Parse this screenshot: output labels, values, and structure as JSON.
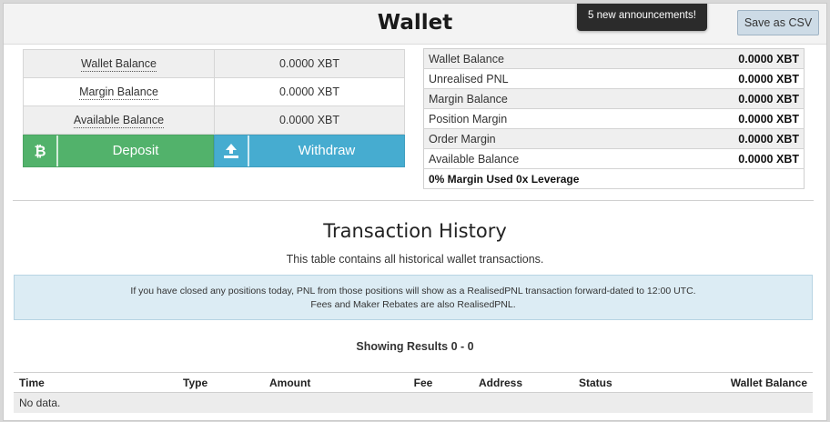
{
  "header": {
    "title": "Wallet",
    "save_csv_label": "Save as CSV",
    "announcement": "5 new announcements!"
  },
  "balances": {
    "rows": [
      {
        "label": "Wallet Balance",
        "value": "0.0000 XBT"
      },
      {
        "label": "Margin Balance",
        "value": "0.0000 XBT"
      },
      {
        "label": "Available Balance",
        "value": "0.0000 XBT"
      }
    ],
    "deposit_label": "Deposit",
    "withdraw_label": "Withdraw",
    "deposit_icon": "bitcoin-icon",
    "withdraw_icon": "upload-icon",
    "deposit_color": "#52b26b",
    "withdraw_color": "#46acd0"
  },
  "summary": {
    "rows": [
      {
        "label": "Wallet Balance",
        "value": "0.0000 XBT"
      },
      {
        "label": "Unrealised PNL",
        "value": "0.0000 XBT"
      },
      {
        "label": "Margin Balance",
        "value": "0.0000 XBT"
      },
      {
        "label": "Position Margin",
        "value": "0.0000 XBT"
      },
      {
        "label": "Order Margin",
        "value": "0.0000 XBT"
      },
      {
        "label": "Available Balance",
        "value": "0.0000 XBT"
      }
    ],
    "footer": "0% Margin Used 0x Leverage"
  },
  "history": {
    "title": "Transaction History",
    "subtitle": "This table contains all historical wallet transactions.",
    "info_line1": "If you have closed any positions today, PNL from those positions will show as a RealisedPNL transaction forward-dated to 12:00 UTC.",
    "info_line2": "Fees and Maker Rebates are also RealisedPNL.",
    "showing": "Showing Results 0 - 0",
    "columns": [
      "Time",
      "Type",
      "Amount",
      "Fee",
      "Address",
      "Status",
      "Wallet Balance"
    ],
    "empty_text": "No data."
  }
}
